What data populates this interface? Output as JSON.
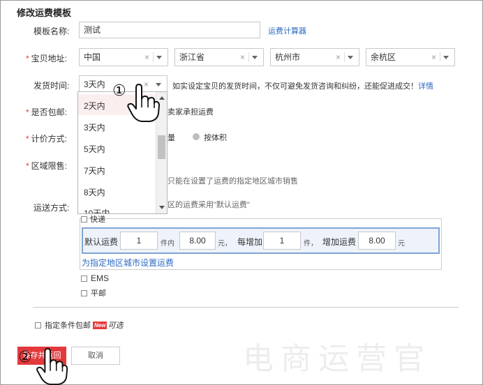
{
  "title": "修改运费模板",
  "template_name": {
    "label": "模板名称:",
    "value": "测试",
    "calc_link": "运费计算器"
  },
  "address": {
    "label": "宝贝地址:",
    "province": "中国",
    "city": "浙江省",
    "district": "杭州市",
    "area": "余杭区",
    "clear": "×"
  },
  "ship_time": {
    "label": "发货时间:",
    "value": "3天内",
    "hint": "如实设定宝贝的发货时间，不仅可避免发货咨询和纠纷，还能促进成交！",
    "hint_link": "详情",
    "options": [
      "2天内",
      "3天内",
      "5天内",
      "7天内",
      "8天内",
      "10天内"
    ]
  },
  "free_ship": {
    "label": "是否包邮:",
    "partial_text": "卖家承担运费"
  },
  "pricing": {
    "label": "计价方式:",
    "partial_text": "量",
    "volume": "按体积"
  },
  "region": {
    "label": "区域限售:",
    "partial_text": "只能在设置了运费的指定地区城市销售"
  },
  "delivery": {
    "label": "运送方式:",
    "partial_text": "区的运费采用\"默认运费\"",
    "express": "快递",
    "default_fee_label": "默认运费",
    "first_qty": "1",
    "first_unit": "件内",
    "first_fee": "8.00",
    "yuan1": "元，",
    "increment_label": "每增加",
    "increment_qty": "1",
    "increment_unit": "件，",
    "extra_fee_label": "增加运费",
    "extra_fee": "8.00",
    "yuan2": "元",
    "region_link": "为指定地区城市设置运费",
    "ems": "EMS",
    "surface_mail": "平邮"
  },
  "conditional": {
    "label": "指定条件包邮",
    "badge": "New",
    "optional": "可选"
  },
  "buttons": {
    "save": "保存并返回",
    "cancel": "取消"
  },
  "annotations": {
    "step1": "①",
    "step2": "②"
  },
  "watermark": "电商运营官"
}
